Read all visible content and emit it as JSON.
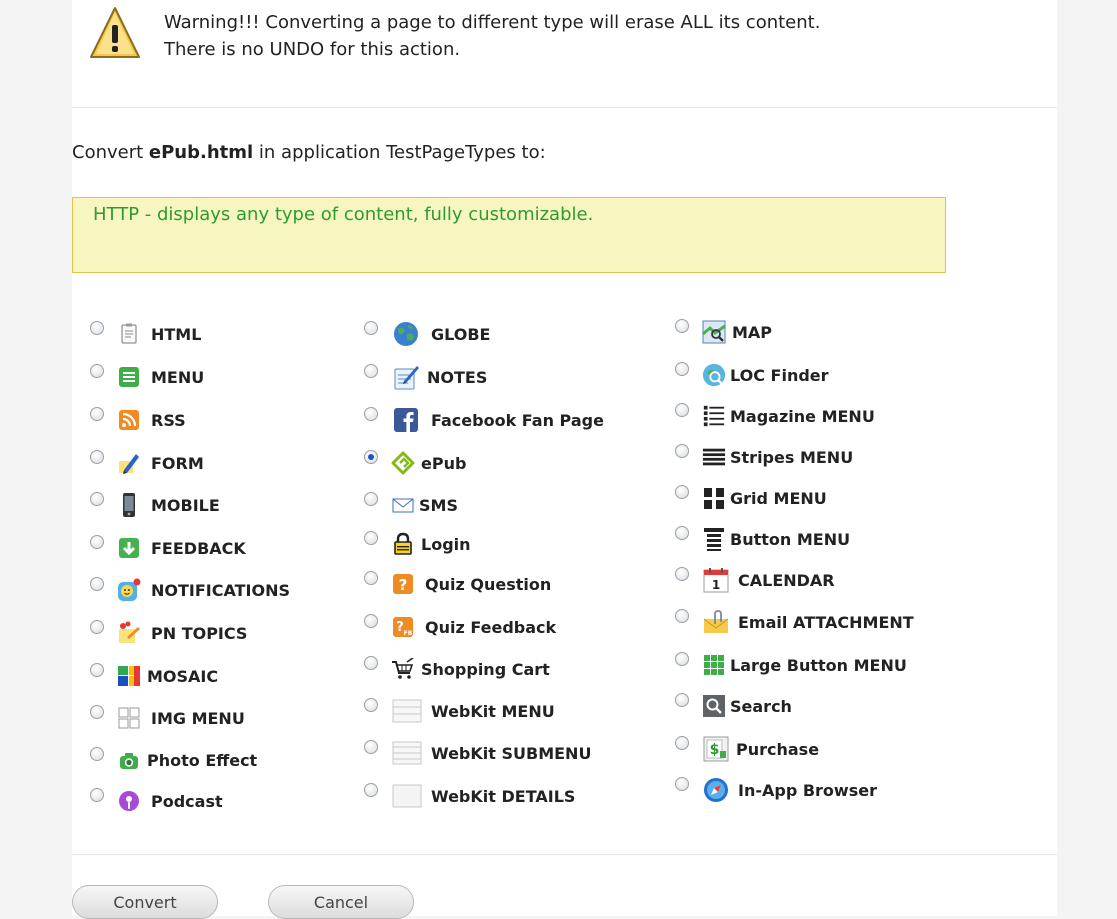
{
  "warning": {
    "line1": "Warning!!! Converting a page to different type will erase ALL its content.",
    "line2": "There is no UNDO for this action."
  },
  "convert": {
    "prefix": "Convert ",
    "file": "ePub.html",
    "suffix": " in application TestPageTypes to:"
  },
  "description": "HTTP - displays any type of content, fully customizable.",
  "options": {
    "col1": [
      {
        "label": "HTML",
        "icon": "html-icon"
      },
      {
        "label": "MENU",
        "icon": "menu-icon"
      },
      {
        "label": "RSS",
        "icon": "rss-icon"
      },
      {
        "label": "FORM",
        "icon": "form-icon"
      },
      {
        "label": "MOBILE",
        "icon": "mobile-icon"
      },
      {
        "label": "FEEDBACK",
        "icon": "feedback-icon"
      },
      {
        "label": "NOTIFICATIONS",
        "icon": "notifications-icon"
      },
      {
        "label": "PN TOPICS",
        "icon": "pn-topics-icon"
      },
      {
        "label": "MOSAIC",
        "icon": "mosaic-icon"
      },
      {
        "label": "IMG MENU",
        "icon": "img-menu-icon"
      },
      {
        "label": "Photo Effect",
        "icon": "photo-effect-icon"
      },
      {
        "label": "Podcast",
        "icon": "podcast-icon"
      }
    ],
    "col2": [
      {
        "label": "GLOBE",
        "icon": "globe-icon"
      },
      {
        "label": "NOTES",
        "icon": "notes-icon"
      },
      {
        "label": "Facebook Fan Page",
        "icon": "facebook-icon"
      },
      {
        "label": "ePub",
        "icon": "epub-icon",
        "selected": true
      },
      {
        "label": "SMS",
        "icon": "envelope-icon"
      },
      {
        "label": "Login",
        "icon": "lock-icon"
      },
      {
        "label": "Quiz Question",
        "icon": "quiz-question-icon"
      },
      {
        "label": "Quiz Feedback",
        "icon": "quiz-feedback-icon"
      },
      {
        "label": "Shopping Cart",
        "icon": "shopping-cart-icon"
      },
      {
        "label": "WebKit MENU",
        "icon": "webkit-menu-icon"
      },
      {
        "label": "WebKit SUBMENU",
        "icon": "webkit-submenu-icon"
      },
      {
        "label": "WebKit DETAILS",
        "icon": "webkit-details-icon"
      }
    ],
    "col3": [
      {
        "label": "MAP",
        "icon": "map-icon"
      },
      {
        "label": "LOC Finder",
        "icon": "loc-finder-icon"
      },
      {
        "label": "Magazine MENU",
        "icon": "magazine-menu-icon"
      },
      {
        "label": "Stripes MENU",
        "icon": "stripes-menu-icon"
      },
      {
        "label": "Grid MENU",
        "icon": "grid-menu-icon"
      },
      {
        "label": "Button MENU",
        "icon": "button-menu-icon"
      },
      {
        "label": "CALENDAR",
        "icon": "calendar-icon"
      },
      {
        "label": "Email ATTACHMENT",
        "icon": "email-attachment-icon"
      },
      {
        "label": "Large Button MENU",
        "icon": "large-button-menu-icon"
      },
      {
        "label": "Search",
        "icon": "search-icon"
      },
      {
        "label": "Purchase",
        "icon": "purchase-icon"
      },
      {
        "label": "In-App Browser",
        "icon": "in-app-browser-icon"
      }
    ]
  },
  "buttons": {
    "convert": "Convert",
    "cancel": "Cancel"
  },
  "colors": {
    "description_bg": "#f8f6c0",
    "description_border": "#e0c44a",
    "description_text": "#2e9a32",
    "radio_selected": "#1c55c8"
  }
}
